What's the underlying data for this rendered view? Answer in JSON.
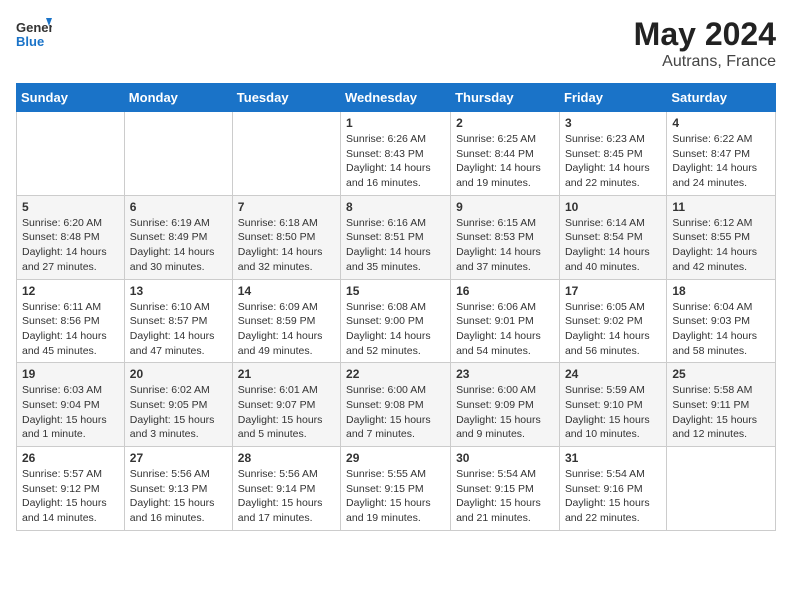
{
  "header": {
    "logo_general": "General",
    "logo_blue": "Blue",
    "month_year": "May 2024",
    "location": "Autrans, France"
  },
  "days_of_week": [
    "Sunday",
    "Monday",
    "Tuesday",
    "Wednesday",
    "Thursday",
    "Friday",
    "Saturday"
  ],
  "weeks": [
    [
      {
        "day": "",
        "info": ""
      },
      {
        "day": "",
        "info": ""
      },
      {
        "day": "",
        "info": ""
      },
      {
        "day": "1",
        "info": "Sunrise: 6:26 AM\nSunset: 8:43 PM\nDaylight: 14 hours and 16 minutes."
      },
      {
        "day": "2",
        "info": "Sunrise: 6:25 AM\nSunset: 8:44 PM\nDaylight: 14 hours and 19 minutes."
      },
      {
        "day": "3",
        "info": "Sunrise: 6:23 AM\nSunset: 8:45 PM\nDaylight: 14 hours and 22 minutes."
      },
      {
        "day": "4",
        "info": "Sunrise: 6:22 AM\nSunset: 8:47 PM\nDaylight: 14 hours and 24 minutes."
      }
    ],
    [
      {
        "day": "5",
        "info": "Sunrise: 6:20 AM\nSunset: 8:48 PM\nDaylight: 14 hours and 27 minutes."
      },
      {
        "day": "6",
        "info": "Sunrise: 6:19 AM\nSunset: 8:49 PM\nDaylight: 14 hours and 30 minutes."
      },
      {
        "day": "7",
        "info": "Sunrise: 6:18 AM\nSunset: 8:50 PM\nDaylight: 14 hours and 32 minutes."
      },
      {
        "day": "8",
        "info": "Sunrise: 6:16 AM\nSunset: 8:51 PM\nDaylight: 14 hours and 35 minutes."
      },
      {
        "day": "9",
        "info": "Sunrise: 6:15 AM\nSunset: 8:53 PM\nDaylight: 14 hours and 37 minutes."
      },
      {
        "day": "10",
        "info": "Sunrise: 6:14 AM\nSunset: 8:54 PM\nDaylight: 14 hours and 40 minutes."
      },
      {
        "day": "11",
        "info": "Sunrise: 6:12 AM\nSunset: 8:55 PM\nDaylight: 14 hours and 42 minutes."
      }
    ],
    [
      {
        "day": "12",
        "info": "Sunrise: 6:11 AM\nSunset: 8:56 PM\nDaylight: 14 hours and 45 minutes."
      },
      {
        "day": "13",
        "info": "Sunrise: 6:10 AM\nSunset: 8:57 PM\nDaylight: 14 hours and 47 minutes."
      },
      {
        "day": "14",
        "info": "Sunrise: 6:09 AM\nSunset: 8:59 PM\nDaylight: 14 hours and 49 minutes."
      },
      {
        "day": "15",
        "info": "Sunrise: 6:08 AM\nSunset: 9:00 PM\nDaylight: 14 hours and 52 minutes."
      },
      {
        "day": "16",
        "info": "Sunrise: 6:06 AM\nSunset: 9:01 PM\nDaylight: 14 hours and 54 minutes."
      },
      {
        "day": "17",
        "info": "Sunrise: 6:05 AM\nSunset: 9:02 PM\nDaylight: 14 hours and 56 minutes."
      },
      {
        "day": "18",
        "info": "Sunrise: 6:04 AM\nSunset: 9:03 PM\nDaylight: 14 hours and 58 minutes."
      }
    ],
    [
      {
        "day": "19",
        "info": "Sunrise: 6:03 AM\nSunset: 9:04 PM\nDaylight: 15 hours and 1 minute."
      },
      {
        "day": "20",
        "info": "Sunrise: 6:02 AM\nSunset: 9:05 PM\nDaylight: 15 hours and 3 minutes."
      },
      {
        "day": "21",
        "info": "Sunrise: 6:01 AM\nSunset: 9:07 PM\nDaylight: 15 hours and 5 minutes."
      },
      {
        "day": "22",
        "info": "Sunrise: 6:00 AM\nSunset: 9:08 PM\nDaylight: 15 hours and 7 minutes."
      },
      {
        "day": "23",
        "info": "Sunrise: 6:00 AM\nSunset: 9:09 PM\nDaylight: 15 hours and 9 minutes."
      },
      {
        "day": "24",
        "info": "Sunrise: 5:59 AM\nSunset: 9:10 PM\nDaylight: 15 hours and 10 minutes."
      },
      {
        "day": "25",
        "info": "Sunrise: 5:58 AM\nSunset: 9:11 PM\nDaylight: 15 hours and 12 minutes."
      }
    ],
    [
      {
        "day": "26",
        "info": "Sunrise: 5:57 AM\nSunset: 9:12 PM\nDaylight: 15 hours and 14 minutes."
      },
      {
        "day": "27",
        "info": "Sunrise: 5:56 AM\nSunset: 9:13 PM\nDaylight: 15 hours and 16 minutes."
      },
      {
        "day": "28",
        "info": "Sunrise: 5:56 AM\nSunset: 9:14 PM\nDaylight: 15 hours and 17 minutes."
      },
      {
        "day": "29",
        "info": "Sunrise: 5:55 AM\nSunset: 9:15 PM\nDaylight: 15 hours and 19 minutes."
      },
      {
        "day": "30",
        "info": "Sunrise: 5:54 AM\nSunset: 9:15 PM\nDaylight: 15 hours and 21 minutes."
      },
      {
        "day": "31",
        "info": "Sunrise: 5:54 AM\nSunset: 9:16 PM\nDaylight: 15 hours and 22 minutes."
      },
      {
        "day": "",
        "info": ""
      }
    ]
  ]
}
